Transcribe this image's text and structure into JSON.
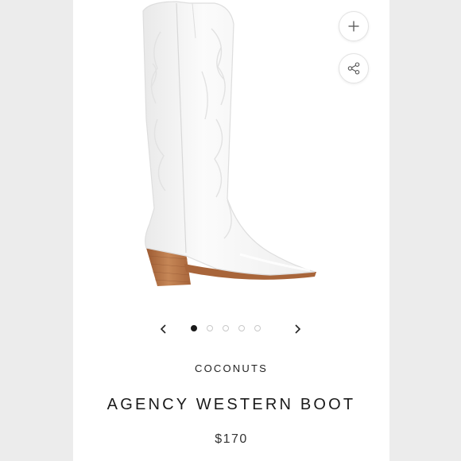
{
  "product": {
    "brand": "COCONUTS",
    "name": "AGENCY WESTERN BOOT",
    "price": "$170",
    "image_alt": "white western boot with stitched embroidery and stacked wood heel"
  },
  "gallery": {
    "total_images": 5,
    "active_index": 0
  },
  "actions": {
    "zoom_icon": "plus-icon",
    "share_icon": "share-icon",
    "prev_icon": "chevron-left-icon",
    "next_icon": "chevron-right-icon"
  },
  "colors": {
    "boot_white": "#f7f7f7",
    "heel_wood": "#b8764a",
    "active_dot": "#1a1a1a"
  }
}
